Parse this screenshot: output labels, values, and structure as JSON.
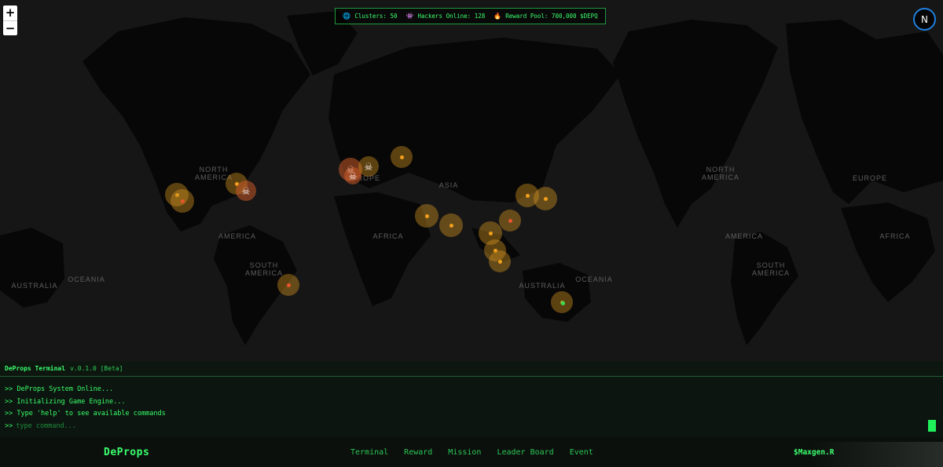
{
  "map": {
    "zoom_in": "+",
    "zoom_out": "−",
    "compass": "N",
    "regions": [
      {
        "id": "north-america-1",
        "label": "NORTH\nAMERICA"
      },
      {
        "id": "south-america-top-1",
        "label": "AMERICA"
      },
      {
        "id": "south-america-1",
        "label": "SOUTH\nAMERICA"
      },
      {
        "id": "europe-1",
        "label": "EUROPE"
      },
      {
        "id": "asia-1",
        "label": "ASIA"
      },
      {
        "id": "africa-1",
        "label": "AFRICA"
      },
      {
        "id": "australia-1",
        "label": "AUSTRALIA"
      },
      {
        "id": "oceania-1",
        "label": "OCEANIA"
      },
      {
        "id": "australia-0",
        "label": "AUSTRALIA"
      },
      {
        "id": "oceania-0",
        "label": "OCEANIA"
      },
      {
        "id": "north-america-2",
        "label": "NORTH\nAMERICA"
      },
      {
        "id": "south-america-top-2",
        "label": "AMERICA"
      },
      {
        "id": "south-america-2",
        "label": "SOUTH\nAMERICA"
      },
      {
        "id": "europe-2",
        "label": "EUROPE"
      },
      {
        "id": "africa-2",
        "label": "AFRICA"
      }
    ],
    "cluster_status_colors": {
      "normal": "#f0a01c",
      "alert": "#e8542c",
      "safe": "#3ddc4f",
      "danger": "#c86a3a"
    },
    "clusters": [
      {
        "status": "normal",
        "icon": "dot"
      },
      {
        "status": "alert",
        "icon": "dot"
      },
      {
        "status": "normal",
        "icon": "dot"
      },
      {
        "status": "danger",
        "icon": "skull"
      },
      {
        "status": "danger",
        "icon": "skull"
      },
      {
        "status": "danger",
        "icon": "skull"
      },
      {
        "status": "normal",
        "icon": "skull"
      },
      {
        "status": "normal",
        "icon": "dot"
      },
      {
        "status": "normal",
        "icon": "dot"
      },
      {
        "status": "normal",
        "icon": "dot"
      },
      {
        "status": "alert",
        "icon": "dot"
      },
      {
        "status": "normal",
        "icon": "dot"
      },
      {
        "status": "normal",
        "icon": "dot"
      },
      {
        "status": "normal",
        "icon": "dot"
      },
      {
        "status": "normal",
        "icon": "dot"
      },
      {
        "status": "normal",
        "icon": "dot"
      },
      {
        "status": "normal",
        "icon": "dot"
      },
      {
        "status": "alert",
        "icon": "dot"
      },
      {
        "status": "safe",
        "icon": "dot"
      }
    ]
  },
  "stats": {
    "clusters_icon": "globe-icon",
    "clusters": "Clusters: 50",
    "hackers_icon": "alien-icon",
    "hackers": "Hackers Online: 128",
    "reward_icon": "fire-icon",
    "reward": "Reward Pool: 700,000 $DEPQ"
  },
  "terminal": {
    "title": "DeProps Terminal",
    "version": "v.0.1.0 [Beta]",
    "lines": [
      ">> DeProps System Online...",
      ">> Initializing Game Engine...",
      ">> Type 'help' to see available commands"
    ],
    "prompt": ">>",
    "placeholder": "type command..."
  },
  "footer": {
    "brand": "DeProps",
    "nav": [
      "Terminal",
      "Reward",
      "Mission",
      "Leader Board",
      "Event"
    ],
    "user": "$Maxgen.R"
  },
  "theme": {
    "accent": "#39ff6a",
    "border": "#1f9a3e",
    "compass_ring": "#1f7fe0"
  }
}
